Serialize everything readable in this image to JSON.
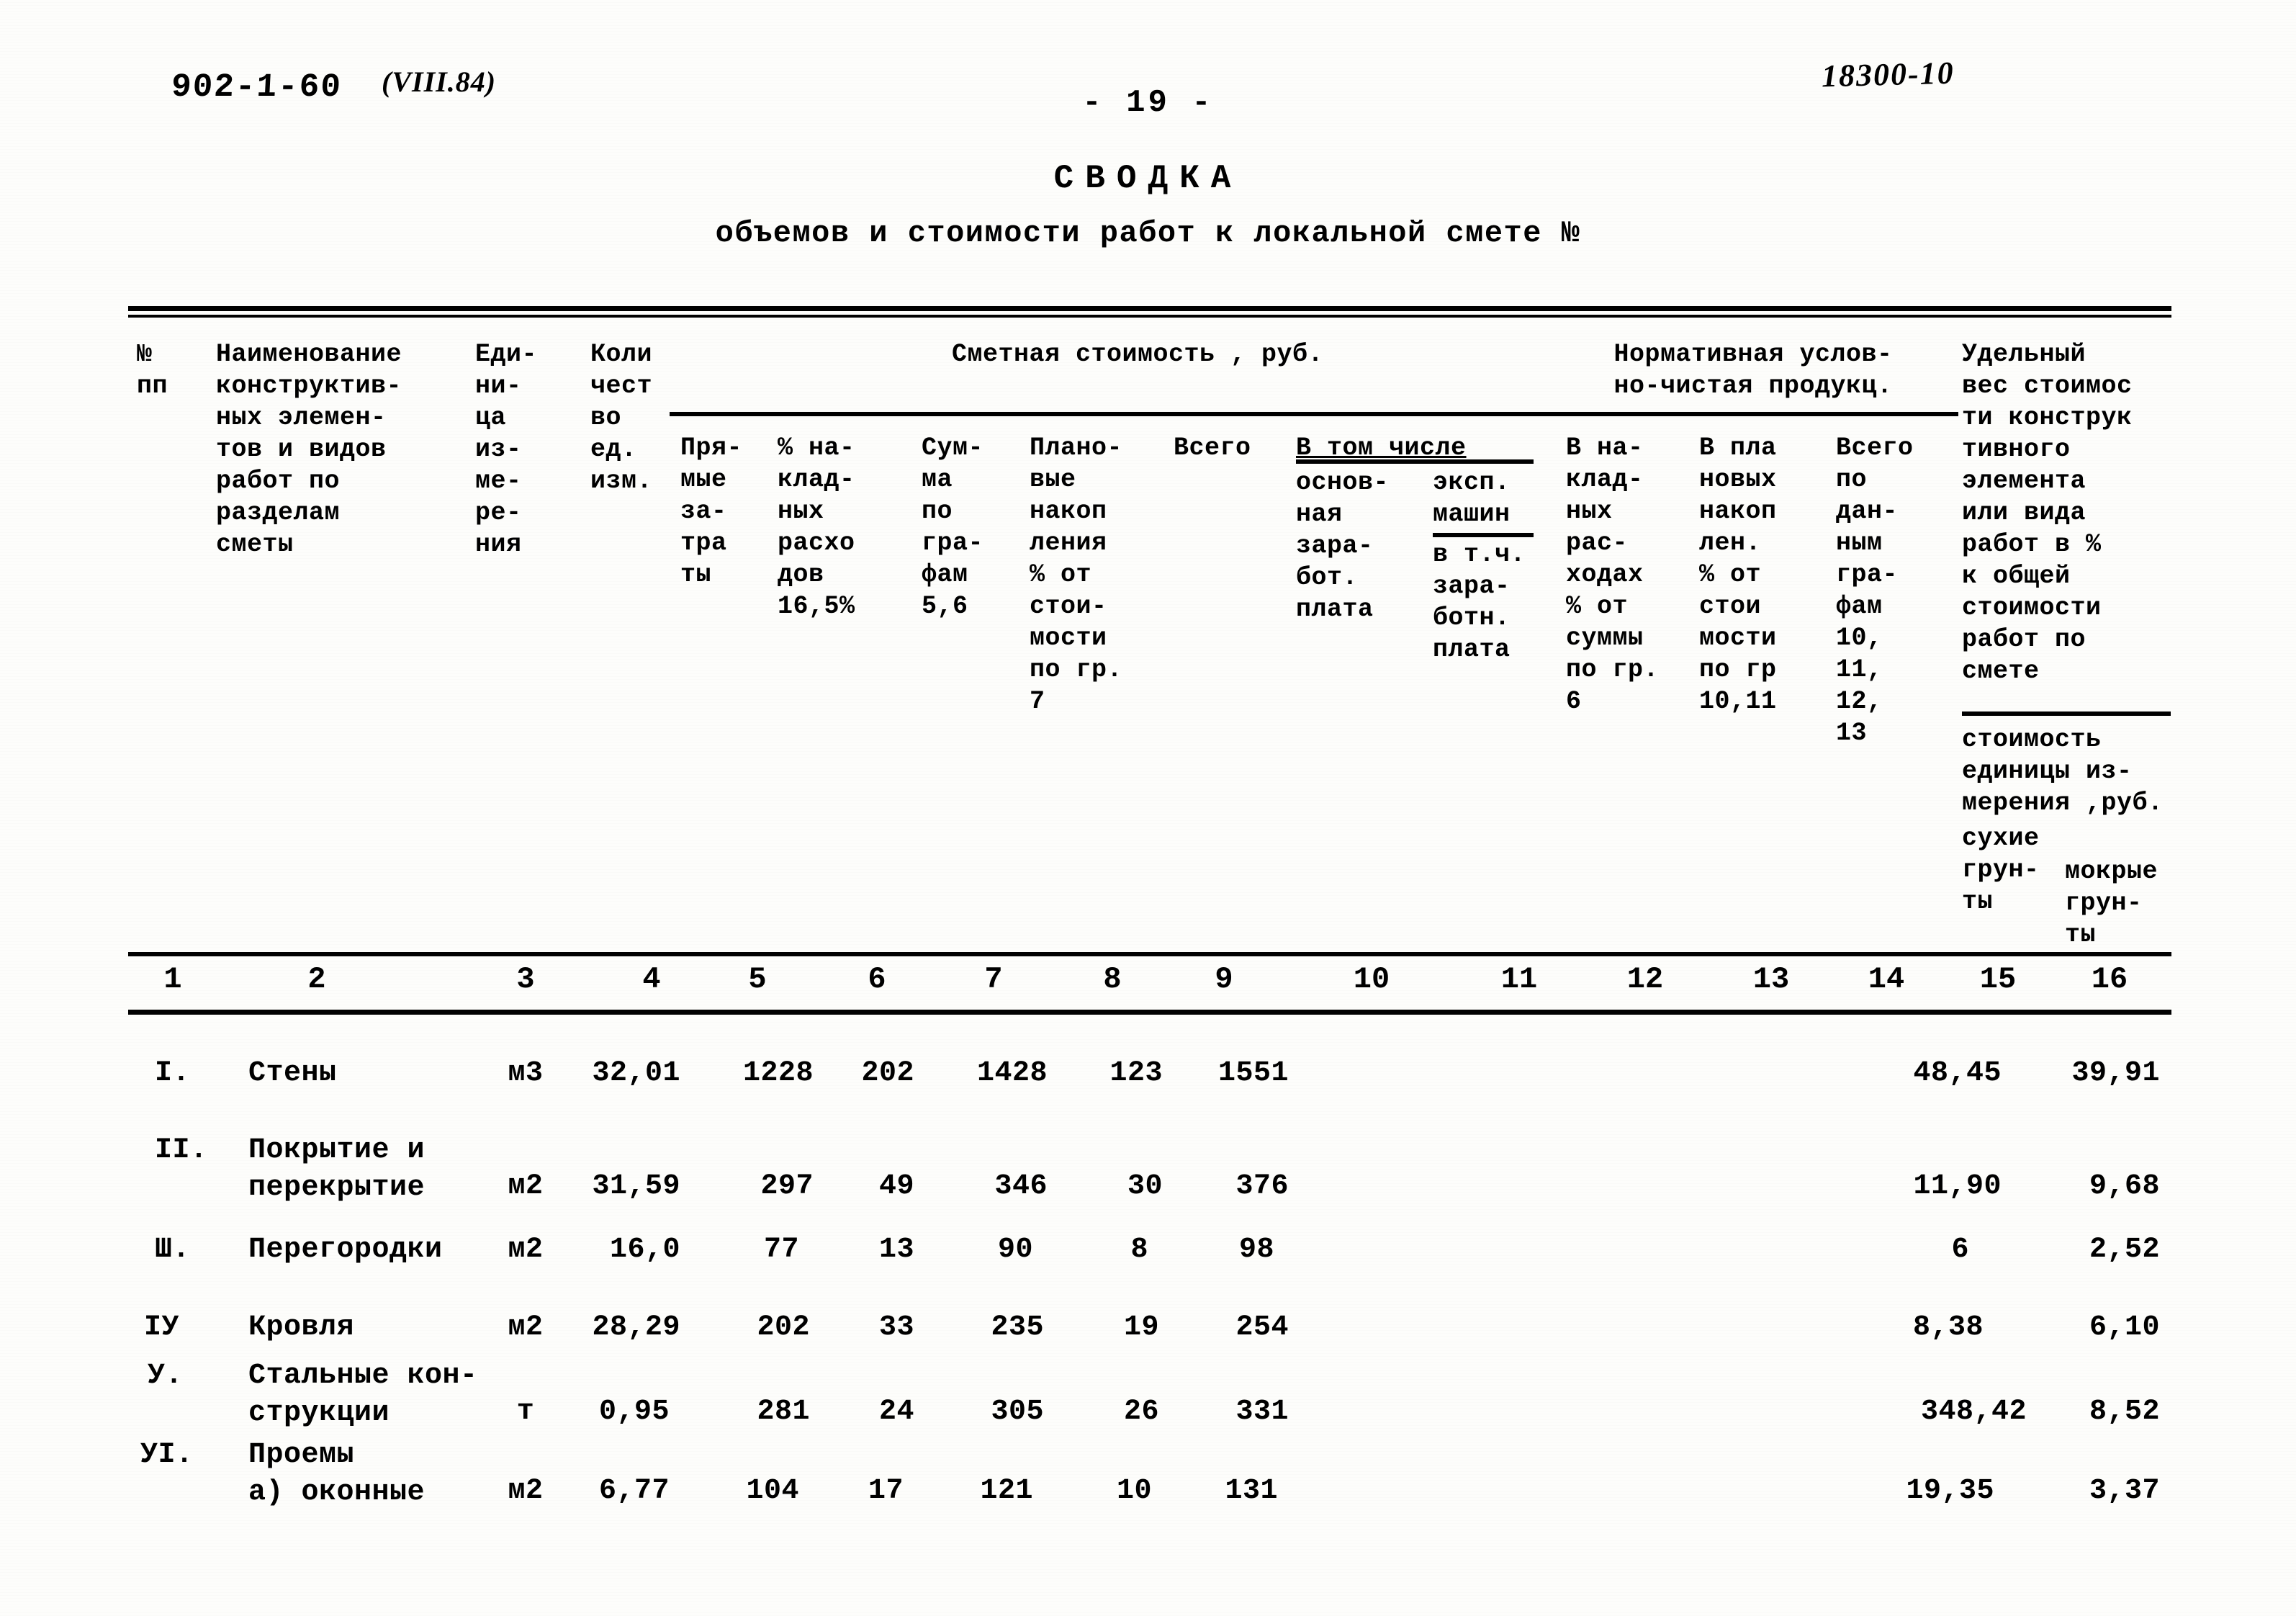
{
  "meta": {
    "doc_code": "902-1-60",
    "doc_revision": "(VIII.84)",
    "page_number": "- 19 -",
    "stamp": "18300-10"
  },
  "title": {
    "main": "СВОДКА",
    "sub": "объемов и стоимости работ к локальной смете №"
  },
  "header": {
    "col1": "№\nпп",
    "col2": "Наименование\nконструктив-\nных элемен-\nтов и видов\nработ по\nразделам\nсметы",
    "col3": "Еди-\nни-\nца\nиз-\nме-\nре-\nния",
    "col4": "Коли\nчест\nво\nед.\nизм.",
    "group_smetnaya": "Сметная стоимость , руб.",
    "col5": "Пря-\nмые\nза-\nтра\nты",
    "col6": "% на-\nклад-\nных\nрасхо\nдов\n16,5%",
    "col7": "Сум-\nма\nпо\nгра-\nфам\n5,6",
    "col8": "Плано-\nвые\nнакоп\nления\n% от\nстои-\nмости\nпо гр.\n 7",
    "col9": "Всего",
    "subgroup_vtomchisle": "В том числе",
    "col10": "основ-\nная\nзара-\nбот.\nплата",
    "col11_top": "эксп.",
    "col11_under": "машин",
    "col11_rest": "в т.ч.\nзара-\nботн.\nплата",
    "group_normativnaya": "Нормативная услов-\nно-чистая продукц.",
    "col12": "В на-\nклад-\nных\nрас-\nходах\n% от\nсуммы\nпо гр.\n   6",
    "col13": "В пла\nновых\nнакоп\nлен.\n% от\nстои\nмости\nпо гр\n10,11",
    "col14": "Всего\nпо\nдан-\nным\nгра-\nфам\n10,\n11,\n12,\n13",
    "col15_16_top": "Удельный\nвес стоимос\nти конструк\nтивного\nэлемента\nили вида\nработ в %\nк общей\nстоимости\nработ по\nсмете",
    "col15_16_sub": "стоимость\nединицы из-\nмерения ,руб.",
    "col15_label": "сухие\nгрун-\nты",
    "col16_label": "мокрые\nгрун-\nты"
  },
  "column_numbers": [
    "1",
    "2",
    "3",
    "4",
    "5",
    "6",
    "7",
    "8",
    "9",
    "10",
    "11",
    "12",
    "13",
    "14",
    "15",
    "16"
  ],
  "rows": [
    {
      "no": "I.",
      "name": "Стены",
      "unit": "м3",
      "qty": "32,01",
      "direct": "1228",
      "overhead": "202",
      "sum_5_6": "1428",
      "planned": "123",
      "total": "1551",
      "basic_wage": "",
      "machines": "",
      "nchp_overhead": "",
      "nchp_planned": "",
      "nchp_total": "",
      "dry": "48,45",
      "wet": "39,91"
    },
    {
      "no": "II.",
      "name": "Покрытие и\nперекрытие",
      "unit": "м2",
      "qty": "31,59",
      "direct": "297",
      "overhead": "49",
      "sum_5_6": "346",
      "planned": "30",
      "total": "376",
      "basic_wage": "",
      "machines": "",
      "nchp_overhead": "",
      "nchp_planned": "",
      "nchp_total": "",
      "dry": "11,90",
      "wet": "9,68"
    },
    {
      "no": "Ш.",
      "name": "Перегородки",
      "unit": "м2",
      "qty": "16,0",
      "direct": "77",
      "overhead": "13",
      "sum_5_6": "90",
      "planned": "8",
      "total": "98",
      "basic_wage": "",
      "machines": "",
      "nchp_overhead": "",
      "nchp_planned": "",
      "nchp_total": "",
      "dry": "6",
      "wet": "2,52"
    },
    {
      "no": "IУ",
      "name": "Кровля",
      "unit": "м2",
      "qty": "28,29",
      "direct": "202",
      "overhead": "33",
      "sum_5_6": "235",
      "planned": "19",
      "total": "254",
      "basic_wage": "",
      "machines": "",
      "nchp_overhead": "",
      "nchp_planned": "",
      "nchp_total": "",
      "dry": "8,38",
      "wet": "6,10"
    },
    {
      "no": "У.",
      "name": "Стальные кон-\nструкции",
      "unit": "т",
      "qty": "0,95",
      "direct": "281",
      "overhead": "24",
      "sum_5_6": "305",
      "planned": "26",
      "total": "331",
      "basic_wage": "",
      "machines": "",
      "nchp_overhead": "",
      "nchp_planned": "",
      "nchp_total": "",
      "dry": "348,42",
      "wet": "8,52"
    },
    {
      "no": "УI.",
      "name": "Проемы\nа) оконные",
      "unit": "м2",
      "qty": "6,77",
      "direct": "104",
      "overhead": "17",
      "sum_5_6": "121",
      "planned": "10",
      "total": "131",
      "basic_wage": "",
      "machines": "",
      "nchp_overhead": "",
      "nchp_planned": "",
      "nchp_total": "",
      "dry": "19,35",
      "wet": "3,37"
    }
  ]
}
